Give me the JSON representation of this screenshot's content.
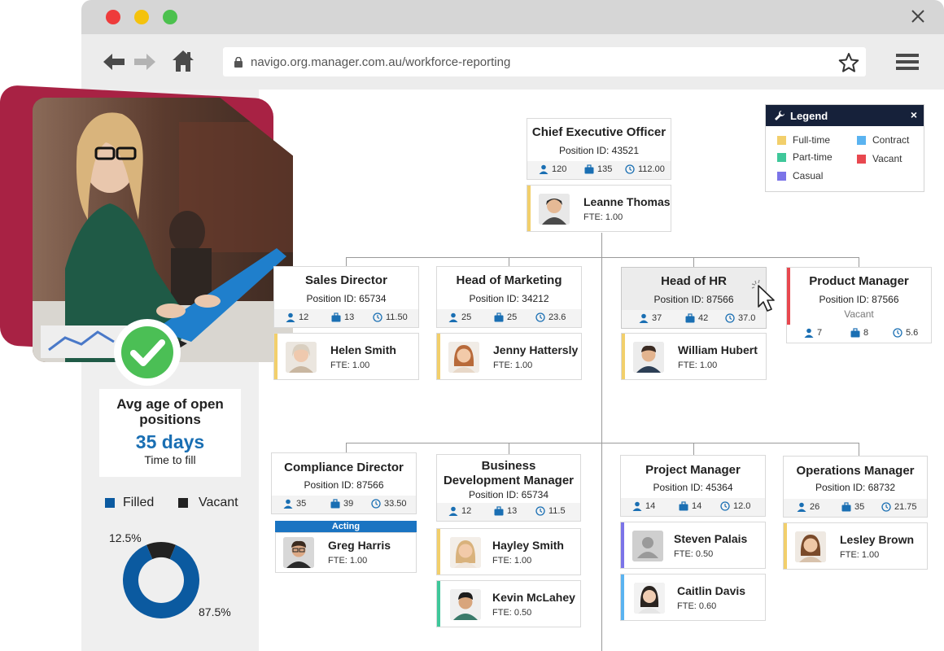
{
  "browser": {
    "url": "navigo.org.manager.com.au/workforce-reporting"
  },
  "avg_card": {
    "title": "Avg age of open positions",
    "value": "35 days",
    "subtitle": "Time to fill"
  },
  "donut_legend": {
    "filled_label": "Filled",
    "vacant_label": "Vacant",
    "filled_color": "#0b5aa0",
    "vacant_color": "#222222"
  },
  "chart_data": {
    "type": "pie",
    "categories": [
      "Filled",
      "Vacant"
    ],
    "values": [
      87.5,
      12.5
    ],
    "labels": [
      "87.5%",
      "12.5%"
    ]
  },
  "legend": {
    "title": "Legend",
    "items": [
      {
        "label": "Full-time",
        "color": "#f2cf6b"
      },
      {
        "label": "Contract",
        "color": "#5ab3f0"
      },
      {
        "label": "Part-time",
        "color": "#3fc79a"
      },
      {
        "label": "Vacant",
        "color": "#e8484f"
      },
      {
        "label": "Casual",
        "color": "#7b74e8"
      }
    ]
  },
  "org": {
    "ceo": {
      "title": "Chief Executive Officer",
      "pid": "Position ID: 43521",
      "s1": "120",
      "s2": "135",
      "s3": "112.00",
      "person": "Leanne Thomas",
      "fte": "FTE: 1.00"
    },
    "sales": {
      "title": "Sales Director",
      "pid": "Position ID: 65734",
      "s1": "12",
      "s2": "13",
      "s3": "11.50",
      "person": "Helen Smith",
      "fte": "FTE: 1.00"
    },
    "marketing": {
      "title": "Head of Marketing",
      "pid": "Position ID: 34212",
      "s1": "25",
      "s2": "25",
      "s3": "23.6",
      "person": "Jenny Hattersly",
      "fte": "FTE: 1.00"
    },
    "hr": {
      "title": "Head of HR",
      "pid": "Position ID: 87566",
      "s1": "37",
      "s2": "42",
      "s3": "37.0",
      "person": "William Hubert",
      "fte": "FTE: 1.00"
    },
    "product": {
      "title": "Product Manager",
      "pid": "Position ID: 87566",
      "vacant": "Vacant",
      "s1": "7",
      "s2": "8",
      "s3": "5.6"
    },
    "compliance": {
      "title": "Compliance Director",
      "pid": "Position ID: 87566",
      "s1": "35",
      "s2": "39",
      "s3": "33.50",
      "acting": "Acting",
      "person": "Greg Harris",
      "fte": "FTE: 1.00"
    },
    "bizdev": {
      "title": "Business Development Manager",
      "pid": "Position ID: 65734",
      "s1": "12",
      "s2": "13",
      "s3": "11.5",
      "person1": "Hayley Smith",
      "fte1": "FTE: 1.00",
      "person2": "Kevin McLahey",
      "fte2": "FTE: 0.50"
    },
    "project": {
      "title": "Project Manager",
      "pid": "Position ID: 45364",
      "s1": "14",
      "s2": "14",
      "s3": "12.0",
      "person1": "Steven Palais",
      "fte1": "FTE: 0.50",
      "person2": "Caitlin Davis",
      "fte2": "FTE: 0.60"
    },
    "operations": {
      "title": "Operations Manager",
      "pid": "Position ID: 68732",
      "s1": "26",
      "s2": "35",
      "s3": "21.75",
      "person": "Lesley Brown",
      "fte": "FTE: 1.00"
    }
  }
}
